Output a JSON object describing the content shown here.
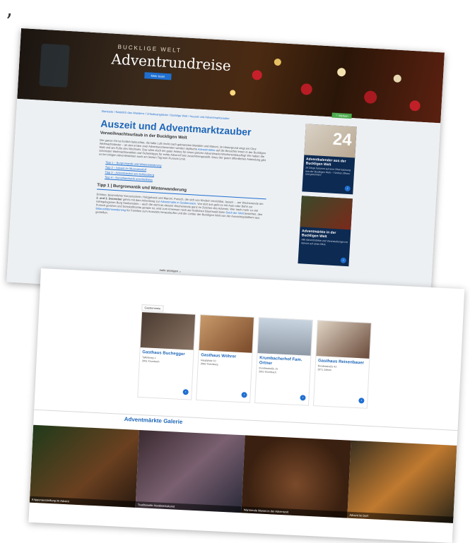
{
  "quote_mark": "’",
  "hero": {
    "subtitle": "BUCKLIGE WELT",
    "title": "Adventrundreise",
    "button": "Mehr lesen"
  },
  "breadcrumb": "Startseite  /  Natürlich das Wandern  /  Urlaubsangebote  /  Bucklige Welt  /  Auszeit und Adventmarktzauber",
  "article": {
    "title": "Auszeit und Adventmarktzauber",
    "subtitle": "Vorweihnachtsurlaub in der Buckligen Welt",
    "p1_a": "Der ganze Ort ist festlich beleuchtet, die kalte Luft riecht nach gebrannten Mandeln und Maroni, im Hintergrund singt ein Chor Weihnachtslieder – an den ersten zwei Adventwochenenden werden idyllische ",
    "p1_link": "Adventmärkte",
    "p1_b": " auf die Besucher:innen in der Buckligen Welt und am Fuße des Wechsels. Das wäre doch ein guter Anlass für einen ganzen Adventmarkt-Wochenendausflug! Wir haben die schönsten Weihnachtsmärkte und Geheimtipps für echte Advent-Fans zusammengestellt. Dazu der guten öffentlichen Anbindung gibt es bei einigen Adventmärkten auch am letzten Tag kein Punsch-Limit.",
    "tips": [
      "Tipp 1 – Burgromantik und Winterwanderung",
      "Tipp 2 – Advent im Museumsdorf",
      "Tipp 3 – Adventzauber am Schlossberg",
      "Tipp 4 – Kunsthandwerk und Wellness"
    ],
    "tip1_heading": "Tipp 1 | Burgromantik und Winterwanderung",
    "p2_a": "Erleben: Besinnlicher Kerzenschein, Holzgeback und Maroni, Punsch, die sich von Kindern erreichbar, lassen ... am Wochenende am ",
    "p2_bold": "2. und 3. Dezember",
    "p2_b": " geht's mit dem Adventzug zur ",
    "p2_link1": "Adventmarkt in Seebenstein",
    "p2_c": ". Von dort aus geht es mit Auto oder Bahn zur nahegelegenen Burg Seebenstein – auch die steht an diesem Wochenende ganz im Zeichen des Advents. Wer nach mehr zu viel Punsch geruhen und Schokolfrüchte gerade ist, wird zum Anwesen noch der festlichen Baumwald beim ",
    "p2_link2": "Dach der Welt",
    "p2_d": " bestehen, den ",
    "p2_link3": "Balaustrittenwanderweg",
    "p2_e": " für Familien zum Auswärts herauslaufen und die Lichter der Buckligen Welt von der Aussichtsplattform aus genießen.",
    "more": "mehr anzeigen",
    "merken": "Merken"
  },
  "sidebar_cards": [
    {
      "title": "Adventkalender aus der Buckligen Welt",
      "desc": "24 Dinge bekannt auf eine Überraschung aus der Buckligen Welt – Türchen öffnen und gewinnen!",
      "number": "24"
    },
    {
      "title": "Adventmärkte in der Buckligen Welt",
      "desc": "Alle Adventmärkte und Veranstaltungen im Advent auf einen Blick"
    }
  ],
  "gastro": {
    "label": "Gastronomie",
    "items": [
      {
        "name": "Gasthaus Buchegger",
        "address": "Talfeldweg 1\n2851 Krumbach"
      },
      {
        "name": "Gasthaus Wöhrer",
        "address": "Hauptplatz 10\n2860 Thernberg"
      },
      {
        "name": "Krumbacherhof Fam. Ortner",
        "address": "Bundesstraße 15\n2851 Krumbach"
      },
      {
        "name": "Gasthaus Reisenbauer",
        "address": "Bundesstraße 42\n2871 Zöbern"
      }
    ]
  },
  "gallery": {
    "title": "Adventmärkte Galerie",
    "items": [
      "Krippenausstellung im Advent",
      "Traditionelle Handwerkskunst",
      "Warmende Maroni in der Adventzeit",
      "Advent im Dorf"
    ]
  },
  "colors": {
    "accent": "#1e66b8",
    "card": "#0d2a52",
    "green": "#4caa4c"
  }
}
